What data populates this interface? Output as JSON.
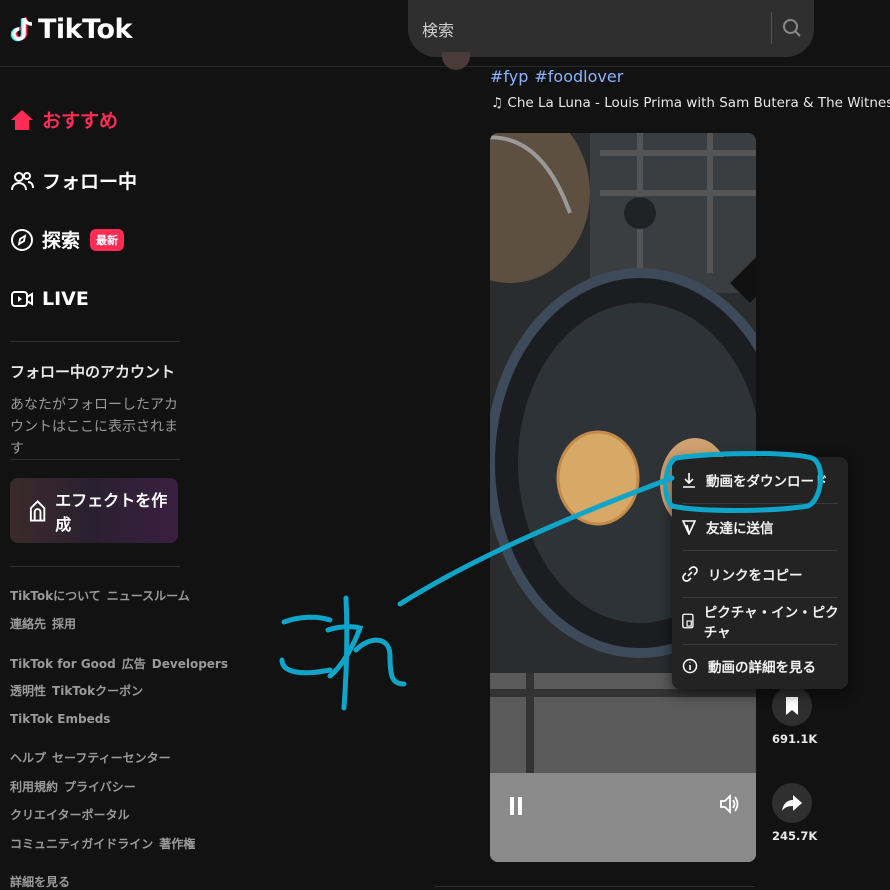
{
  "header": {
    "logo_text": "TikTok",
    "search": {
      "placeholder": "検索"
    }
  },
  "sidebar": {
    "nav": [
      {
        "label": "おすすめ",
        "icon": "home-icon",
        "active": true
      },
      {
        "label": "フォロー中",
        "icon": "people-icon"
      },
      {
        "label": "探索",
        "icon": "compass-icon",
        "badge": "最新"
      },
      {
        "label": "LIVE",
        "icon": "live-icon"
      }
    ],
    "following_title": "フォロー中のアカウント",
    "following_desc": "あなたがフォローしたアカウントはここに表示されます",
    "effect_button": "エフェクトを作成",
    "footer": [
      [
        "TikTokについて",
        "ニュースルーム"
      ],
      [
        "連絡先",
        "採用"
      ],
      [
        "TikTok for Good",
        "広告",
        "Developers"
      ],
      [
        "透明性",
        "TikTokクーポン"
      ],
      [
        "TikTok Embeds"
      ],
      [
        "ヘルプ",
        "セーフティーセンター"
      ],
      [
        "利用規約",
        "プライバシー"
      ],
      [
        "クリエイターポータル"
      ],
      [
        "コミュニティガイドライン",
        "著作権"
      ],
      [
        "詳細を見る"
      ]
    ]
  },
  "post": {
    "tags": [
      "#fyp",
      "#foodlover"
    ],
    "music": "Che La Luna - Louis Prima with Sam Butera & The Witnesses"
  },
  "actions": {
    "save_count": "691.1K",
    "share_count": "245.7K"
  },
  "context_menu": {
    "items": [
      {
        "label": "動画をダウンロード",
        "icon": "download-icon"
      },
      {
        "label": "友達に送信",
        "icon": "send-icon"
      },
      {
        "label": "リンクをコピー",
        "icon": "link-icon"
      },
      {
        "label": "ピクチャ・イン・ピクチャ",
        "icon": "pip-icon"
      },
      {
        "label": "動画の詳細を見る",
        "icon": "info-icon"
      }
    ]
  },
  "annotation": {
    "text": "これ",
    "color": "#0ea5c8"
  },
  "colors": {
    "accent": "#fe2c55",
    "link": "#8ab4ff",
    "background": "#121212"
  }
}
